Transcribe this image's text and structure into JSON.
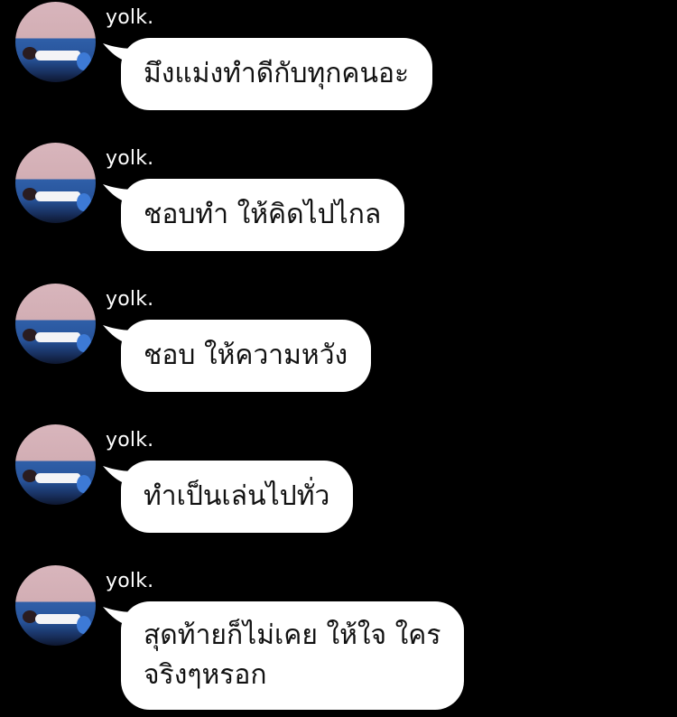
{
  "messages": [
    {
      "sender": "yolk.",
      "lines": [
        "มึงแม่งทำดีกับทุกคนอะ"
      ]
    },
    {
      "sender": "yolk.",
      "lines": [
        "ชอบทำ ให้คิดไปไกล"
      ]
    },
    {
      "sender": "yolk.",
      "lines": [
        "ชอบ ให้ความหวัง"
      ]
    },
    {
      "sender": "yolk.",
      "lines": [
        "ทำเป็นเล่นไปทั่ว"
      ]
    },
    {
      "sender": "yolk.",
      "lines": [
        "สุดท้ายก็ไม่เคย ให้ใจ ใคร",
        "จริงๆหรอก"
      ]
    }
  ],
  "colors": {
    "background": "#000000",
    "bubble": "#ffffff",
    "bubble_text": "#111111",
    "sender_name": "#ffffff"
  },
  "icons": {
    "avatar": "profile-photo-person-lying-on-blue-sofa"
  }
}
